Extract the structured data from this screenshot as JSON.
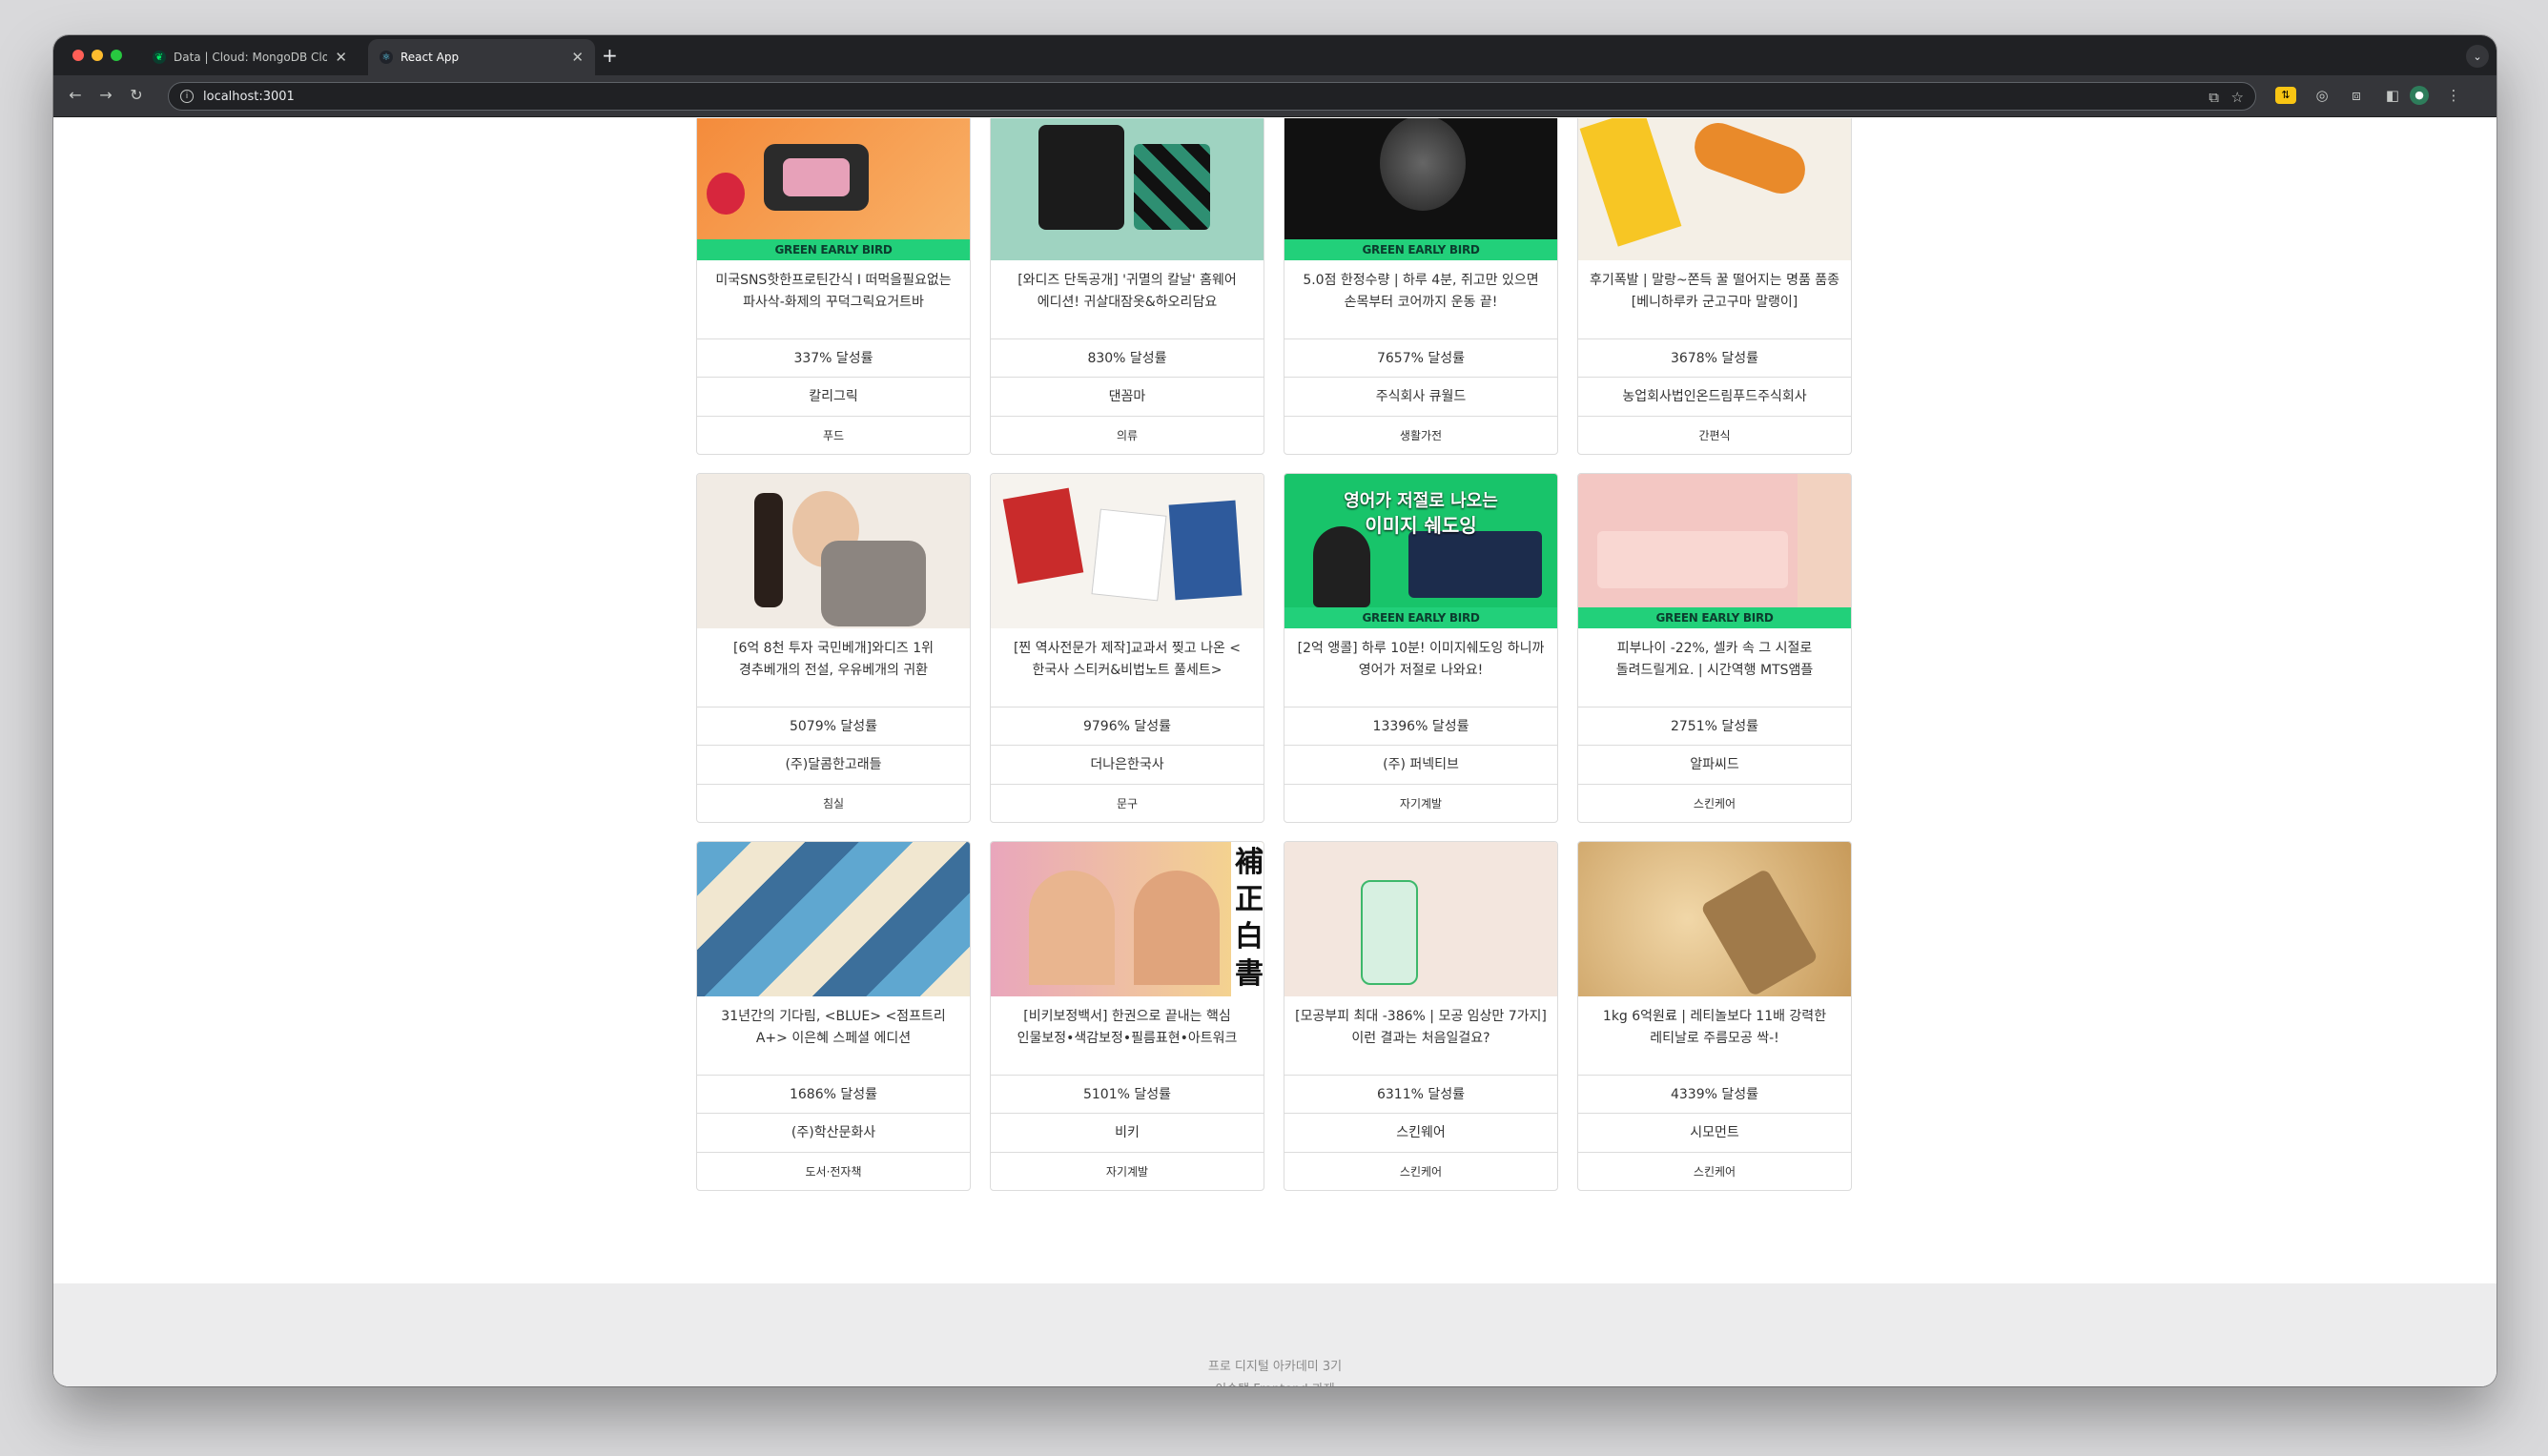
{
  "browser": {
    "tabs": [
      {
        "title": "Data | Cloud: MongoDB Cloud",
        "icon": "mongodb-leaf-icon",
        "active": false
      },
      {
        "title": "React App",
        "icon": "react-icon",
        "active": true
      }
    ],
    "url": "localhost:3001"
  },
  "products": [
    {
      "title": "미국SNS핫한프로틴간식 I 떠먹을필요없는 파사삭-화제의 꾸덕그릭요거트바",
      "rate": "337% 달성률",
      "maker": "칼리그릭",
      "category": "푸드",
      "early_bird": "GREEN EARLY BIRD"
    },
    {
      "title": "[와디즈 단독공개] '귀멸의 칼날' 홈웨어 에디션! 귀살대잠옷&하오리담요",
      "rate": "830% 달성률",
      "maker": "댄꼼마",
      "category": "의류",
      "early_bird": ""
    },
    {
      "title": "5.0점 한정수량 | 하루 4분, 쥐고만 있으면 손목부터 코어까지 운동 끝!",
      "rate": "7657% 달성률",
      "maker": "주식회사 큐월드",
      "category": "생활가전",
      "early_bird": "GREEN EARLY BIRD"
    },
    {
      "title": "후기폭발 | 말랑~쫀득 꿀 떨어지는 명품 품종 [베니하루카 군고구마 말랭이]",
      "rate": "3678% 달성률",
      "maker": "농업회사법인온드림푸드주식회사",
      "category": "간편식",
      "early_bird": ""
    },
    {
      "title": "[6억 8천 투자 국민베개]와디즈 1위 경추베개의 전설, 우유베개의 귀환",
      "rate": "5079% 달성률",
      "maker": "(주)달콤한고래들",
      "category": "침실",
      "early_bird": ""
    },
    {
      "title": "[찐 역사전문가 제작]교과서 찢고 나온 < 한국사 스티커&비법노트 풀세트>",
      "rate": "9796% 달성률",
      "maker": "더나은한국사",
      "category": "문구",
      "early_bird": ""
    },
    {
      "title": "[2억 앵콜] 하루 10분! 이미지쉐도잉 하니까 영어가 저절로 나와요!",
      "rate": "13396% 달성률",
      "maker": "(주) 퍼넥티브",
      "category": "자기계발",
      "early_bird": "GREEN EARLY BIRD",
      "image_text": [
        "영어가 저절로 나오는",
        "이미지 쉐도잉"
      ]
    },
    {
      "title": "피부나이 -22%, 셀카 속 그 시절로 돌려드릴게요. | 시간역행 MTS앰플",
      "rate": "2751% 달성률",
      "maker": "알파씨드",
      "category": "스킨케어",
      "early_bird": "GREEN EARLY BIRD"
    },
    {
      "title": "31년간의 기다림, <BLUE> <점프트리 A+> 이은혜 스페셜 에디션",
      "rate": "1686% 달성률",
      "maker": "(주)학산문화사",
      "category": "도서·전자책",
      "early_bird": ""
    },
    {
      "title": "[비키보정백서] 한권으로 끝내는 핵심 인물보정•색감보정•필름표현•아트워크",
      "rate": "5101% 달성률",
      "maker": "비키",
      "category": "자기계발",
      "early_bird": "",
      "image_text": [
        "補",
        "正",
        "白",
        "書"
      ]
    },
    {
      "title": "[모공부피 최대 -386% | 모공 임상만 7가지] 이런 결과는 처음일걸요?",
      "rate": "6311% 달성률",
      "maker": "스킨웨어",
      "category": "스킨케어",
      "early_bird": ""
    },
    {
      "title": "1kg 6억원료 | 레티놀보다 11배 강력한 레티날로 주름모공 싹-!",
      "rate": "4339% 달성률",
      "maker": "시모먼트",
      "category": "스킨케어",
      "early_bird": ""
    }
  ],
  "footer": {
    "line1": "프로 디지털 아카데미 3기",
    "line2": "이승택 Frontend 과제"
  },
  "colors": {
    "early_bird_green": "#22d07a",
    "card_border": "#dcdcdc",
    "footer_bg": "#ececed"
  }
}
